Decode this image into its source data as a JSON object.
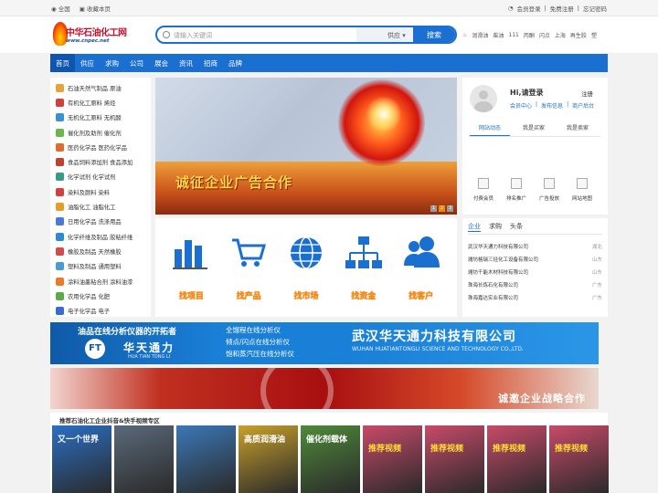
{
  "topbar": {
    "home": "全国",
    "favorite": "收藏本页",
    "login": "会员登录",
    "register": "免费注册",
    "forgot": "忘记密码"
  },
  "logo": {
    "name": "中华石油化工网",
    "url": "www.cnpec.net"
  },
  "search": {
    "placeholder": "请输入关键词",
    "type": "供应",
    "button": "搜索"
  },
  "hot_words": [
    "润滑油",
    "柴油",
    "111",
    "丙酮",
    "闪点",
    "上海",
    "再生胶",
    "塑"
  ],
  "nav": [
    "首页",
    "供应",
    "求购",
    "公司",
    "展会",
    "资讯",
    "招商",
    "品牌"
  ],
  "categories": [
    {
      "label": "石油天然气制品 原油",
      "color": "#e8a23a"
    },
    {
      "label": "有机化工原料 烯烃",
      "color": "#d2403a"
    },
    {
      "label": "无机化工原料 无机酸",
      "color": "#3a8fd6"
    },
    {
      "label": "催化剂及助剂 催化剂",
      "color": "#6bb84a"
    },
    {
      "label": "医药化学品 医药化学品",
      "color": "#e46a2a"
    },
    {
      "label": "食品饲料添加剂 食品添加",
      "color": "#c4402e"
    },
    {
      "label": "化学试剂 化学试剂",
      "color": "#3a9a8a"
    },
    {
      "label": "染料及颜料 染料",
      "color": "#d2403a"
    },
    {
      "label": "油脂化工 油脂化工",
      "color": "#e89a2a"
    },
    {
      "label": "日用化学品 洗涤用品",
      "color": "#4a7ad6"
    },
    {
      "label": "化学纤维及制品 胶粘纤维",
      "color": "#2a8ad6"
    },
    {
      "label": "橡胶及制品 天然橡胶",
      "color": "#d64a4a"
    },
    {
      "label": "塑料及制品 通用塑料",
      "color": "#4a9ad6"
    },
    {
      "label": "涂料油墨粘合剂 涂料油漆",
      "color": "#e87a2a"
    },
    {
      "label": "农用化学品 化肥",
      "color": "#5aaa4a"
    },
    {
      "label": "电子化学品 电子",
      "color": "#3a6ad6"
    }
  ],
  "banner": {
    "slogan": "诚征企业广告合作",
    "pages": [
      "1",
      "2",
      "3"
    ]
  },
  "tools": [
    "找项目",
    "找产品",
    "找市场",
    "找资金",
    "找客户"
  ],
  "user": {
    "greeting": "Hi,请登录",
    "register": "注册",
    "links": [
      "会员中心",
      "发布信息",
      "商户后台"
    ],
    "tabs": [
      "网站动态",
      "我是买家",
      "我是卖家"
    ],
    "icons": [
      "付费会员",
      "排名推广",
      "广告投放",
      "网站地图"
    ]
  },
  "news": {
    "tabs": [
      "企业",
      "求购",
      "头条"
    ],
    "items": [
      {
        "name": "武汉华天通力科技有限公司",
        "region": "湖北"
      },
      {
        "name": "潍坊格瑞三烃化工设备有限公司",
        "region": "山东"
      },
      {
        "name": "潍坊千能木材科技有限公司",
        "region": "山东"
      },
      {
        "name": "珠海长炼石化有限公司",
        "region": "广东"
      },
      {
        "name": "珠海嘉达实业有限公司",
        "region": "广东"
      }
    ]
  },
  "ad1": {
    "tagline": "油品在线分析仪器的开拓者",
    "logo_mark": "FT",
    "brand_cn": "华天通力",
    "brand_en": "HUA TIAN TONG LI",
    "lines": [
      "全馏程在线分析仪",
      "倾点/闪点在线分析仪",
      "饱和蒸汽压在线分析仪"
    ],
    "company": "武汉华天通力科技有限公司",
    "company_en": "WUHAN HUATIANTONGLI SCIENCE AND TECHNOLOGY CO.,LTD."
  },
  "ad2": {
    "slogan": "诚邀企业战略合作"
  },
  "recommend": {
    "title": "推荐石油化工企业抖音&快手视频专区",
    "thumbs": [
      {
        "text": "又一个世界",
        "color": "#2b6fc4"
      },
      {
        "text": "",
        "color": "#5a6a7a"
      },
      {
        "text": "",
        "color": "#3b78b8"
      },
      {
        "text": "高质润滑油",
        "color": "#c8a02a"
      },
      {
        "text": "催化剂载体",
        "color": "#4f8a3a"
      },
      {
        "text": "推荐视频",
        "color": "#c84a6a"
      },
      {
        "text": "推荐视频",
        "color": "#c84a6a"
      },
      {
        "text": "推荐视频",
        "color": "#c84a6a"
      },
      {
        "text": "推荐视频",
        "color": "#c84a6a"
      }
    ]
  }
}
